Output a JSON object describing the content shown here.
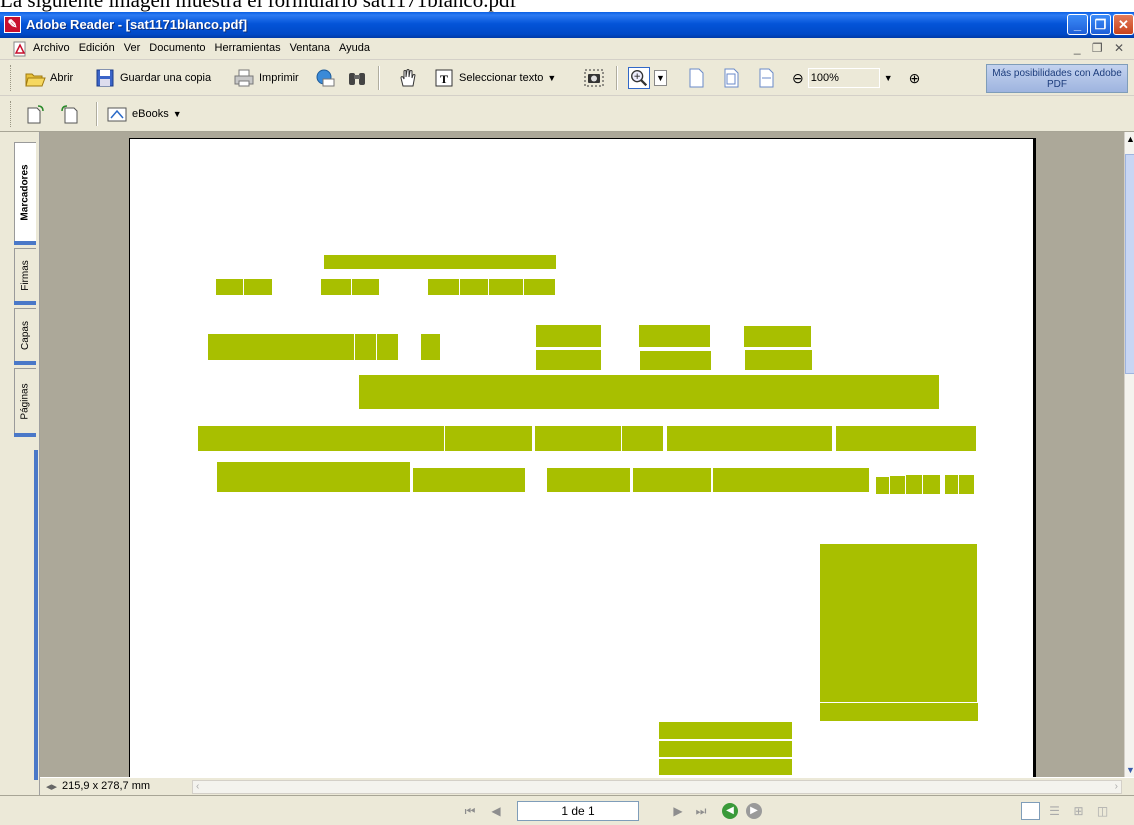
{
  "caption": "La siguiente imagen muestra el formulario sat1171blanco.pdf",
  "window": {
    "title": "Adobe Reader - [sat1171blanco.pdf]",
    "minimize": "_",
    "restore": "❐",
    "close": "✕"
  },
  "menu": {
    "items": [
      "Archivo",
      "Edición",
      "Ver",
      "Documento",
      "Herramientas",
      "Ventana",
      "Ayuda"
    ],
    "mdi_controls": "_ ❐ ✕"
  },
  "toolbar": {
    "open_label": "Abrir",
    "save_copy_label": "Guardar una copia",
    "print_label": "Imprimir",
    "select_text_label": "Seleccionar texto",
    "zoom_value": "100%",
    "promo_label": "Más posibilidades con Adobe PDF"
  },
  "toolbar2": {
    "ebooks_label": "eBooks"
  },
  "nav_tabs": [
    "Marcadores",
    "Firmas",
    "Capas",
    "Páginas"
  ],
  "status": {
    "page_size": "215,9 x 278,7 mm"
  },
  "navigation": {
    "page_indicator": "1 de 1"
  },
  "colors": {
    "form_field": "#a8bf00",
    "titlebar": "#0454d8",
    "chrome": "#ece9d8",
    "doc_background": "#aca899"
  }
}
